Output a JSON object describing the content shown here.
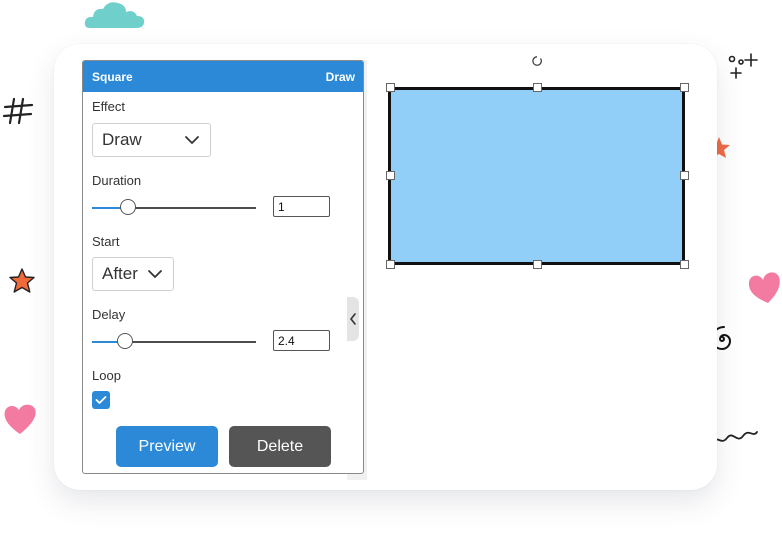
{
  "panel": {
    "title": "Square",
    "effect_tag": "Draw",
    "effect": {
      "label": "Effect",
      "value": "Draw"
    },
    "duration": {
      "label": "Duration",
      "value": "1",
      "slider_fraction": 0.22
    },
    "start": {
      "label": "Start",
      "value": "After"
    },
    "delay": {
      "label": "Delay",
      "value": "2.4",
      "slider_fraction": 0.2
    },
    "loop": {
      "label": "Loop",
      "checked": true
    },
    "buttons": {
      "preview": "Preview",
      "delete": "Delete"
    }
  },
  "canvas": {
    "shape": {
      "type": "rectangle",
      "fill": "#92cff8",
      "stroke": "#111111"
    }
  },
  "colors": {
    "accent": "#2b89d7",
    "secondary_button": "#555555"
  },
  "icons": [
    "chevron-down-icon",
    "check-icon",
    "chevron-left-icon",
    "rotate-handle-icon",
    "cloud-icon",
    "heart-icon",
    "star-icon",
    "sparkle-icon",
    "hashtag-icon",
    "spiral-icon",
    "squiggle-icon"
  ]
}
